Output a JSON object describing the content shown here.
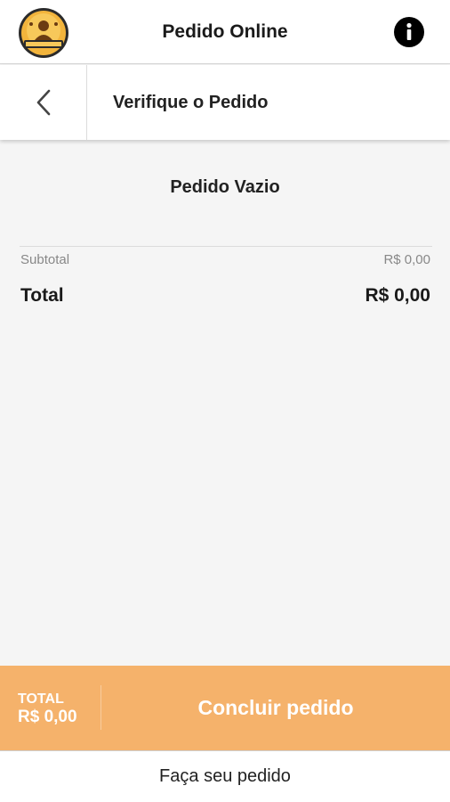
{
  "header": {
    "app_title": "Pedido Online",
    "logo_icon": "restaurant-logo-icon",
    "info_icon": "info-icon"
  },
  "subheader": {
    "back_icon": "chevron-left-icon",
    "title": "Verifique o Pedido"
  },
  "order": {
    "empty_message": "Pedido Vazio",
    "subtotal_label": "Subtotal",
    "subtotal_value": "R$ 0,00",
    "total_label": "Total",
    "total_value": "R$ 0,00"
  },
  "footer": {
    "total_label": "TOTAL",
    "total_value": "R$ 0,00",
    "conclude_label": "Concluir pedido"
  },
  "bottom_tab": {
    "label": "Faça seu pedido"
  },
  "colors": {
    "accent": "#f5b26b",
    "background": "#f5f5f5",
    "text": "#222222"
  }
}
